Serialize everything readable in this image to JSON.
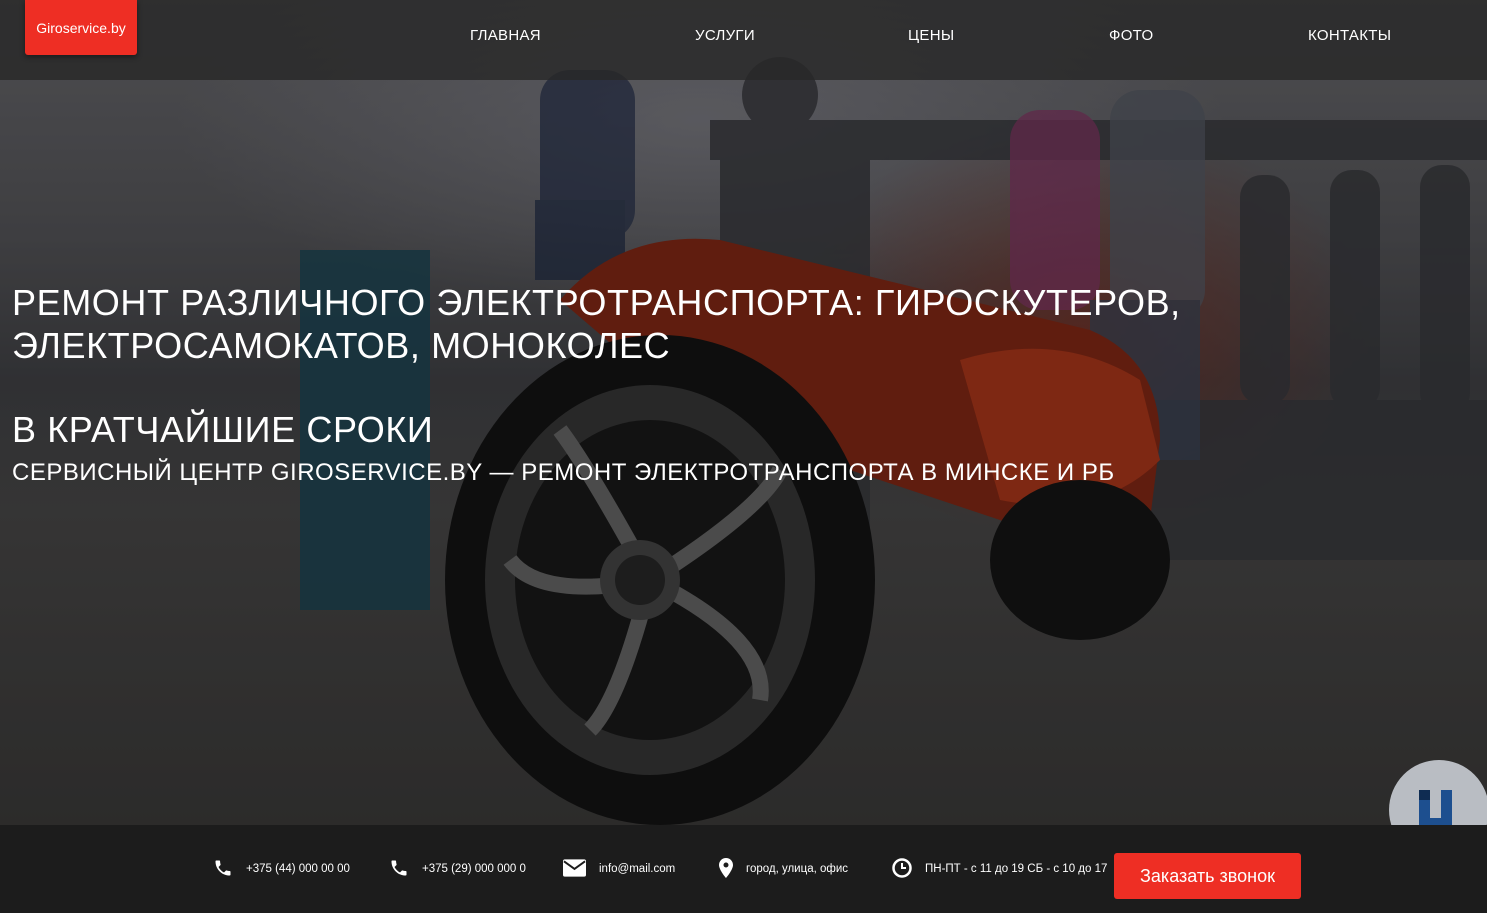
{
  "header": {
    "logo_text": "Giroservice.by",
    "nav": [
      {
        "label": "ГЛАВНАЯ"
      },
      {
        "label": "УСЛУГИ"
      },
      {
        "label": "ЦЕНЫ"
      },
      {
        "label": "ФОТО"
      },
      {
        "label": "КОНТАКТЫ"
      }
    ]
  },
  "hero": {
    "title": "РЕМОНТ РАЗЛИЧНОГО ЭЛЕКТРОТРАНСПОРТА: ГИРОСКУТЕРОВ, ЭЛЕКТРОСАМОКАТОВ, МОНОКОЛЕС",
    "subtitle": "В КРАТЧАЙШИЕ СРОКИ",
    "tagline": "СЕРВИСНЫЙ ЦЕНТР GIROSERVICE.BY — РЕМОНТ ЭЛЕКТРОТРАНСПОРТА В МИНСКЕ И РБ"
  },
  "footer": {
    "phone1": {
      "icon": "phone-icon",
      "text": "+375 (44) 000 00 00"
    },
    "phone2": {
      "icon": "phone-icon",
      "text": "+375 (29) 000 000 0"
    },
    "email": {
      "icon": "envelope-icon",
      "text": "info@mail.com"
    },
    "address": {
      "icon": "map-pin-icon",
      "text": "город, улица, офис"
    },
    "hours": {
      "icon": "clock-icon",
      "text": "ПН-ПТ - с 11 до 19 СБ - с 10 до 17"
    },
    "cta_label": "Заказать звонок"
  },
  "colors": {
    "accent": "#ee2e24",
    "header_bg": "#282828",
    "footer_bg": "#1c1c1c"
  }
}
